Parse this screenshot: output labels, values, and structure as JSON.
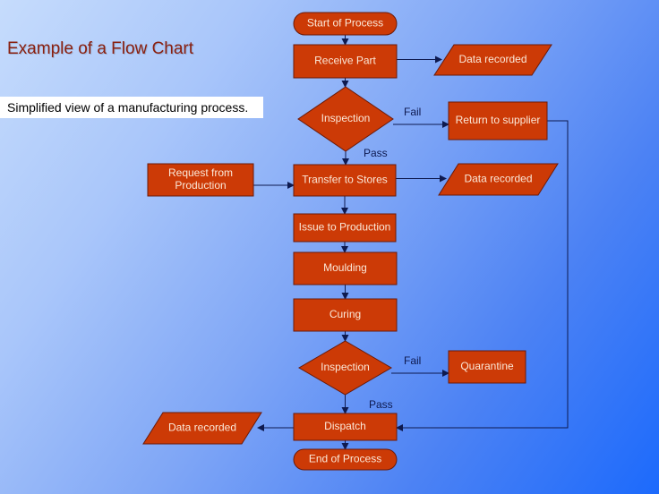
{
  "title": "Example of a Flow Chart",
  "subtitle": "Simplified view of a manufacturing process.",
  "colors": {
    "node_fill": "#cc3a06",
    "node_text": "#fbe8d8",
    "edge": "#0e1a50",
    "title": "#8a2010"
  },
  "nodes": [
    {
      "id": "start",
      "type": "terminator",
      "label": "Start of Process"
    },
    {
      "id": "receive",
      "type": "process",
      "label": "Receive Part"
    },
    {
      "id": "data1",
      "type": "data",
      "label": "Data recorded"
    },
    {
      "id": "inspect1",
      "type": "decision",
      "label": "Inspection"
    },
    {
      "id": "return",
      "type": "process",
      "label": "Return to supplier"
    },
    {
      "id": "request",
      "type": "process",
      "label": "Request from Production",
      "lines": [
        "Request from",
        "Production"
      ]
    },
    {
      "id": "transfer",
      "type": "process",
      "label": "Transfer to Stores"
    },
    {
      "id": "data2",
      "type": "data",
      "label": "Data recorded"
    },
    {
      "id": "issue",
      "type": "process",
      "label": "Issue to Production"
    },
    {
      "id": "moulding",
      "type": "process",
      "label": "Moulding"
    },
    {
      "id": "curing",
      "type": "process",
      "label": "Curing"
    },
    {
      "id": "inspect2",
      "type": "decision",
      "label": "Inspection"
    },
    {
      "id": "quarantine",
      "type": "process",
      "label": "Quarantine"
    },
    {
      "id": "dispatch",
      "type": "process",
      "label": "Dispatch"
    },
    {
      "id": "data3",
      "type": "data",
      "label": "Data recorded"
    },
    {
      "id": "end",
      "type": "terminator",
      "label": "End of Process"
    }
  ],
  "edges": [
    {
      "from": "start",
      "to": "receive",
      "label": ""
    },
    {
      "from": "receive",
      "to": "data1",
      "label": ""
    },
    {
      "from": "receive",
      "to": "inspect1",
      "label": ""
    },
    {
      "from": "inspect1",
      "to": "return",
      "label": "Fail"
    },
    {
      "from": "inspect1",
      "to": "transfer",
      "label": "Pass"
    },
    {
      "from": "request",
      "to": "transfer",
      "label": ""
    },
    {
      "from": "transfer",
      "to": "data2",
      "label": ""
    },
    {
      "from": "transfer",
      "to": "issue",
      "label": ""
    },
    {
      "from": "issue",
      "to": "moulding",
      "label": ""
    },
    {
      "from": "moulding",
      "to": "curing",
      "label": ""
    },
    {
      "from": "curing",
      "to": "inspect2",
      "label": ""
    },
    {
      "from": "inspect2",
      "to": "quarantine",
      "label": "Fail"
    },
    {
      "from": "inspect2",
      "to": "dispatch",
      "label": "Pass"
    },
    {
      "from": "dispatch",
      "to": "data3",
      "label": ""
    },
    {
      "from": "dispatch",
      "to": "end",
      "label": ""
    },
    {
      "from": "return",
      "to": "dispatch",
      "label": ""
    }
  ]
}
